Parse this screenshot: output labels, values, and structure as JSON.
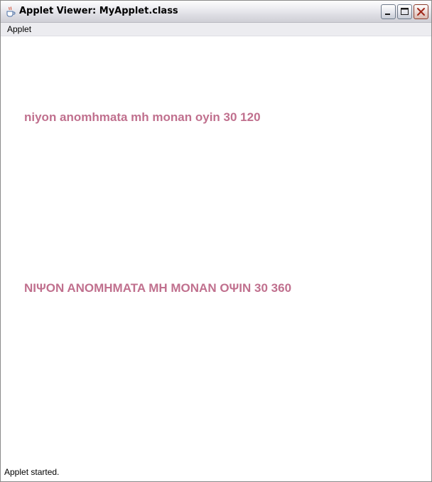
{
  "window": {
    "title": "Applet Viewer: MyApplet.class",
    "icon": "java-coffee-cup-icon"
  },
  "window_controls": {
    "minimize_icon": "minimize-icon",
    "maximize_icon": "maximize-icon",
    "close_icon": "close-icon"
  },
  "menubar": {
    "items": [
      {
        "label": "Applet"
      }
    ]
  },
  "applet": {
    "text_color": "#c0708e",
    "lines": [
      {
        "text": "niyon anomhmata mh monan oyin 30 120"
      },
      {
        "text": "NIΨON ANOMHMATA MH MONAN OΨIN 30 360"
      }
    ]
  },
  "status": {
    "text": "Applet started."
  }
}
